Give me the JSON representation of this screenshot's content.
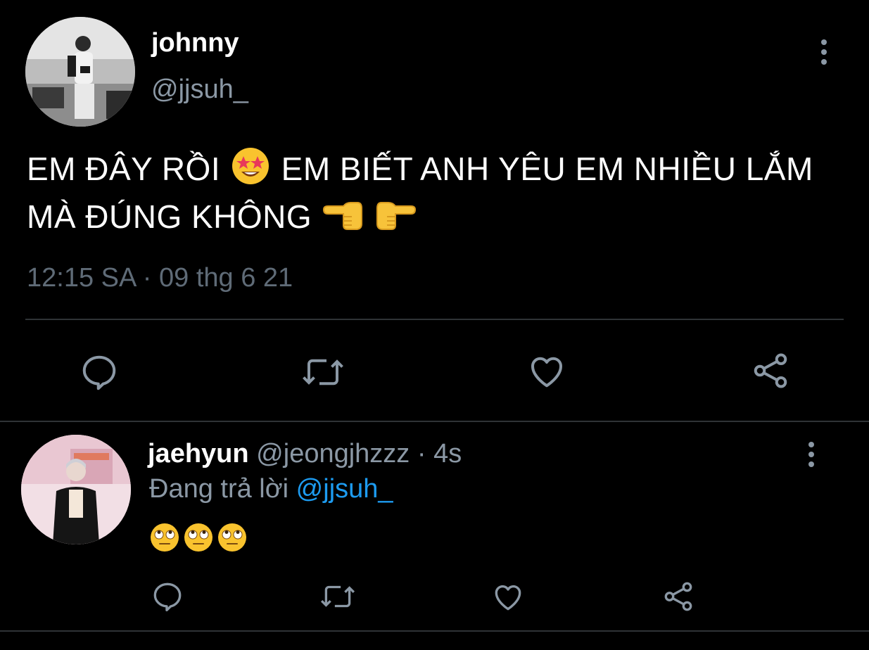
{
  "main_tweet": {
    "display_name": "johnny",
    "handle": "@jjsuh_",
    "text_part1": "EM ĐÂY RỒI",
    "text_part2": "EM BIẾT ANH YÊU EM NHIỀU LẮM MÀ ĐÚNG KHÔNG",
    "emoji1": "star-struck-face-icon",
    "emoji2": "backhand-index-pointing-left-icon",
    "emoji3": "backhand-index-pointing-right-icon",
    "timestamp": "12:15 SA · 09 thg 6 21",
    "actions": [
      "reply-icon",
      "retweet-icon",
      "like-icon",
      "share-icon"
    ]
  },
  "reply_tweet": {
    "display_name": "jaehyun",
    "handle": "@jeongjhzzz",
    "separator": "·",
    "time_ago": "4s",
    "replying_label": "Đang trả lời",
    "replying_to": "@jjsuh_",
    "emojis": [
      "face-with-rolling-eyes-icon",
      "face-with-rolling-eyes-icon",
      "face-with-rolling-eyes-icon"
    ],
    "actions": [
      "reply-icon",
      "retweet-icon",
      "like-icon",
      "share-icon"
    ]
  },
  "colors": {
    "background": "#000000",
    "primary_text": "#ffffff",
    "secondary_text": "#8b98a5",
    "accent": "#1d9bf0",
    "divider": "#2f3336"
  }
}
